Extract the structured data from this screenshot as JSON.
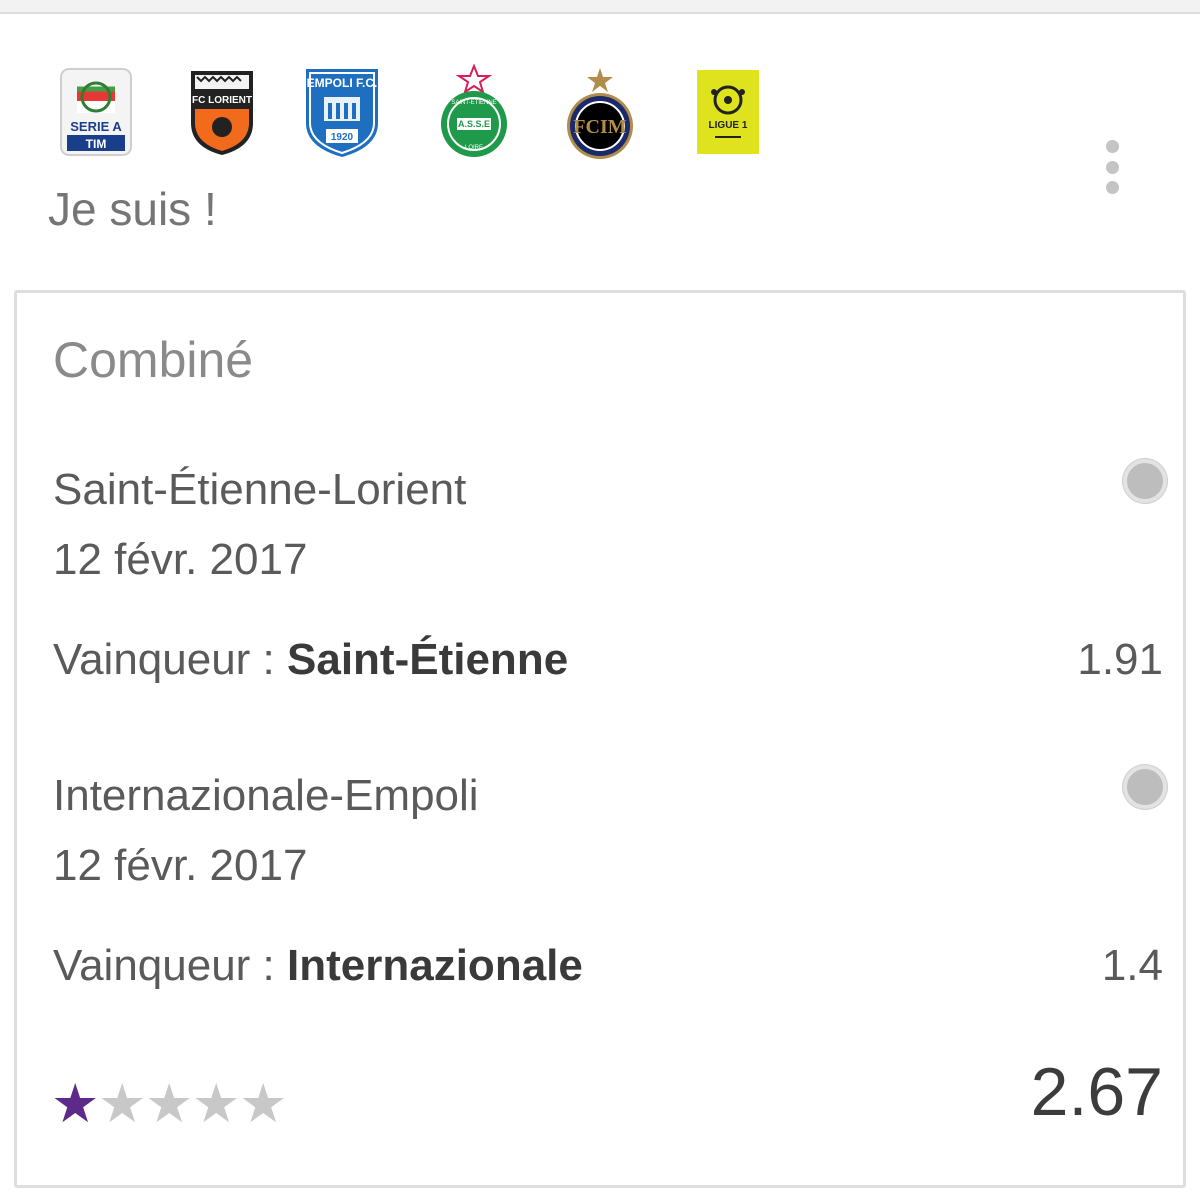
{
  "header": {
    "logos": [
      {
        "name": "serie-a-logo",
        "text": "SERIE A TIM"
      },
      {
        "name": "fc-lorient-logo",
        "text": "FC LORIENT"
      },
      {
        "name": "empoli-fc-logo",
        "text": "EMPOLI F.C. 1920"
      },
      {
        "name": "asse-logo",
        "text": "SAINT-ÉTIENNE A.S.S.E LOIRE"
      },
      {
        "name": "inter-logo",
        "text": "FCIM"
      },
      {
        "name": "ligue-1-logo",
        "text": "LIGUE 1"
      }
    ],
    "more_icon": "more-vertical-icon"
  },
  "subtitle": "Je suis !",
  "card": {
    "title": "Combiné",
    "matches": [
      {
        "name": "Saint-Étienne-Lorient",
        "date": "12 févr. 2017",
        "pick_label": "Vainqueur : ",
        "pick_team": "Saint-Étienne",
        "odds": "1.91"
      },
      {
        "name": "Internazionale-Empoli",
        "date": "12 févr. 2017",
        "pick_label": "Vainqueur : ",
        "pick_team": "Internazionale",
        "odds": "1.4"
      }
    ],
    "rating": {
      "value": 1,
      "max": 5
    },
    "total_odds": "2.67"
  },
  "colors": {
    "star_active": "#5e2a8a",
    "star_inactive": "#c8c8c8",
    "ligue1_yellow": "#dfe31d",
    "lorient_orange": "#f26a1b",
    "asse_green": "#1f9a4a",
    "empoli_blue": "#1f6fc0",
    "inter_blue": "#1b2a6b"
  }
}
